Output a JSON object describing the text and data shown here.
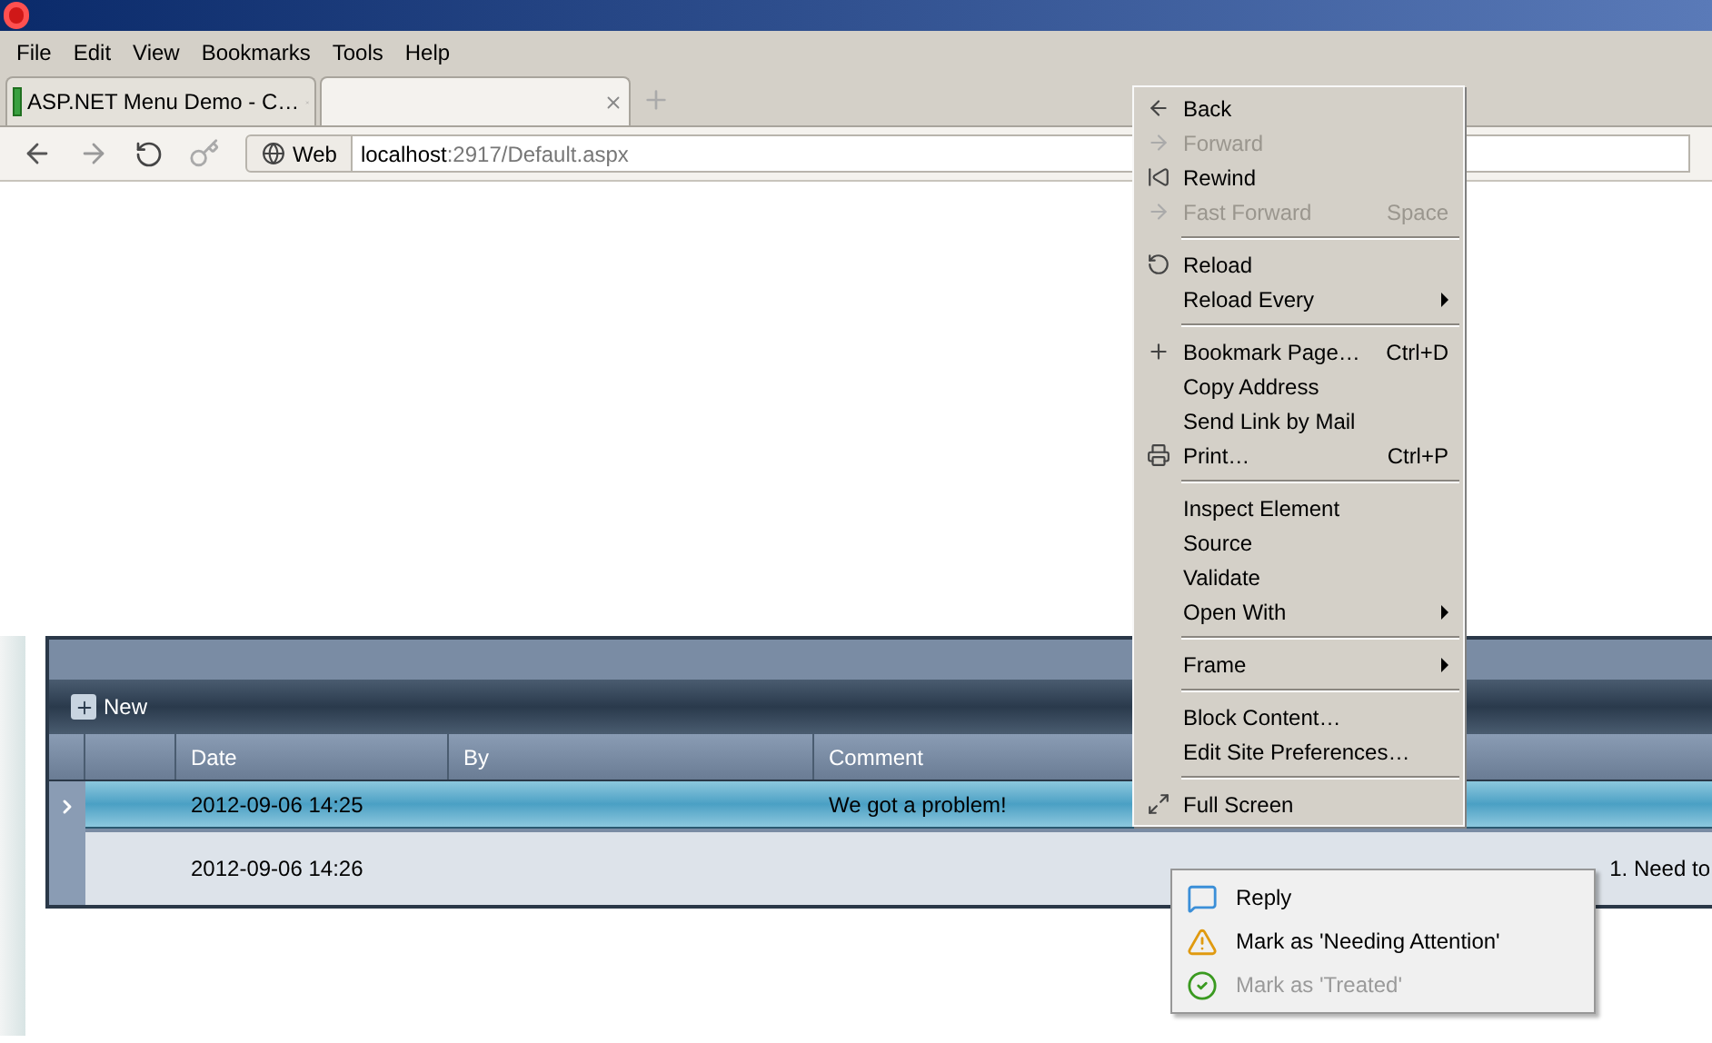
{
  "menu_bar": [
    "File",
    "Edit",
    "View",
    "Bookmarks",
    "Tools",
    "Help"
  ],
  "tabs": [
    {
      "label": "ASP.NET Menu Demo - C…",
      "selected": false
    },
    {
      "selected": true
    }
  ],
  "address_bar": {
    "badge": "Web",
    "host": "localhost",
    "path": ":2917/Default.aspx"
  },
  "grid": {
    "toolbar_button": "New",
    "columns": [
      "Date",
      "By",
      "Comment"
    ],
    "rows": [
      {
        "date": "2012-09-06 14:25",
        "comment": "We got a problem!",
        "selected": true
      },
      {
        "date": "2012-09-06 14:26",
        "comment": "1. Need to",
        "selected": false
      }
    ]
  },
  "context_menu": [
    {
      "kind": "item",
      "label": "Back",
      "disabled": false
    },
    {
      "kind": "item",
      "label": "Forward",
      "disabled": true
    },
    {
      "kind": "item",
      "label": "Rewind",
      "disabled": false
    },
    {
      "kind": "item",
      "label": "Fast Forward",
      "shortcut": "Space",
      "disabled": true
    },
    {
      "kind": "separator"
    },
    {
      "kind": "item",
      "label": "Reload",
      "disabled": false
    },
    {
      "kind": "submenu",
      "label": "Reload Every",
      "disabled": false
    },
    {
      "kind": "separator"
    },
    {
      "kind": "item",
      "label": "Bookmark Page…",
      "shortcut": "Ctrl+D",
      "disabled": false
    },
    {
      "kind": "item",
      "label": "Copy Address",
      "disabled": false
    },
    {
      "kind": "item",
      "label": "Send Link by Mail",
      "disabled": false
    },
    {
      "kind": "item",
      "label": "Print…",
      "shortcut": "Ctrl+P",
      "disabled": false
    },
    {
      "kind": "separator"
    },
    {
      "kind": "item",
      "label": "Inspect Element",
      "disabled": false
    },
    {
      "kind": "item",
      "label": "Source",
      "disabled": false
    },
    {
      "kind": "item",
      "label": "Validate",
      "disabled": false
    },
    {
      "kind": "submenu",
      "label": "Open With",
      "disabled": false
    },
    {
      "kind": "separator"
    },
    {
      "kind": "submenu",
      "label": "Frame",
      "disabled": false
    },
    {
      "kind": "separator"
    },
    {
      "kind": "item",
      "label": "Block Content…",
      "disabled": false
    },
    {
      "kind": "item",
      "label": "Edit Site Preferences…",
      "disabled": false
    },
    {
      "kind": "separator"
    },
    {
      "kind": "item",
      "label": "Full Screen",
      "disabled": false
    }
  ],
  "row_menu": [
    {
      "label": "Reply",
      "disabled": false
    },
    {
      "label": "Mark as 'Needing Attention'",
      "disabled": false
    },
    {
      "label": "Mark as 'Treated'",
      "disabled": true
    }
  ]
}
